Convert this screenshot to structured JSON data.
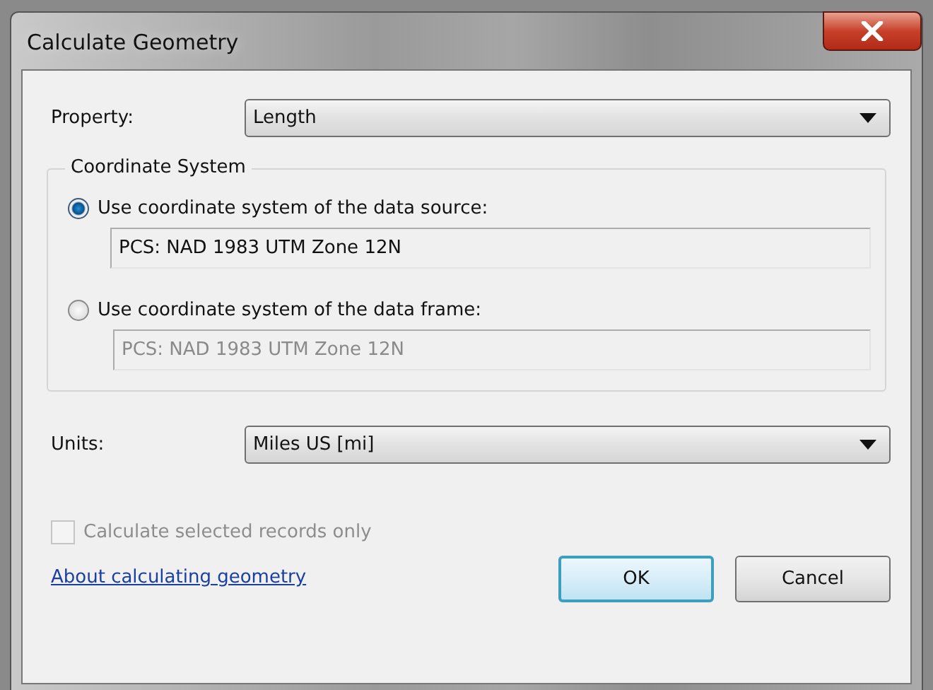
{
  "window": {
    "title": "Calculate Geometry"
  },
  "property": {
    "label": "Property:",
    "value": "Length"
  },
  "coordinate_system": {
    "title": "Coordinate System",
    "options": [
      {
        "label": "Use coordinate system of the data source:",
        "selected": true,
        "value": "PCS: NAD 1983 UTM Zone 12N",
        "disabled": false
      },
      {
        "label": "Use coordinate system of the data frame:",
        "selected": false,
        "value": "PCS: NAD 1983 UTM Zone 12N",
        "disabled": true
      }
    ]
  },
  "units": {
    "label": "Units:",
    "value": "Miles US [mi]"
  },
  "selected_only": {
    "label": "Calculate selected records only",
    "checked": false,
    "disabled": true
  },
  "help_link": "About calculating geometry",
  "buttons": [
    {
      "label": "OK",
      "default": true
    },
    {
      "label": "Cancel",
      "default": false
    }
  ]
}
